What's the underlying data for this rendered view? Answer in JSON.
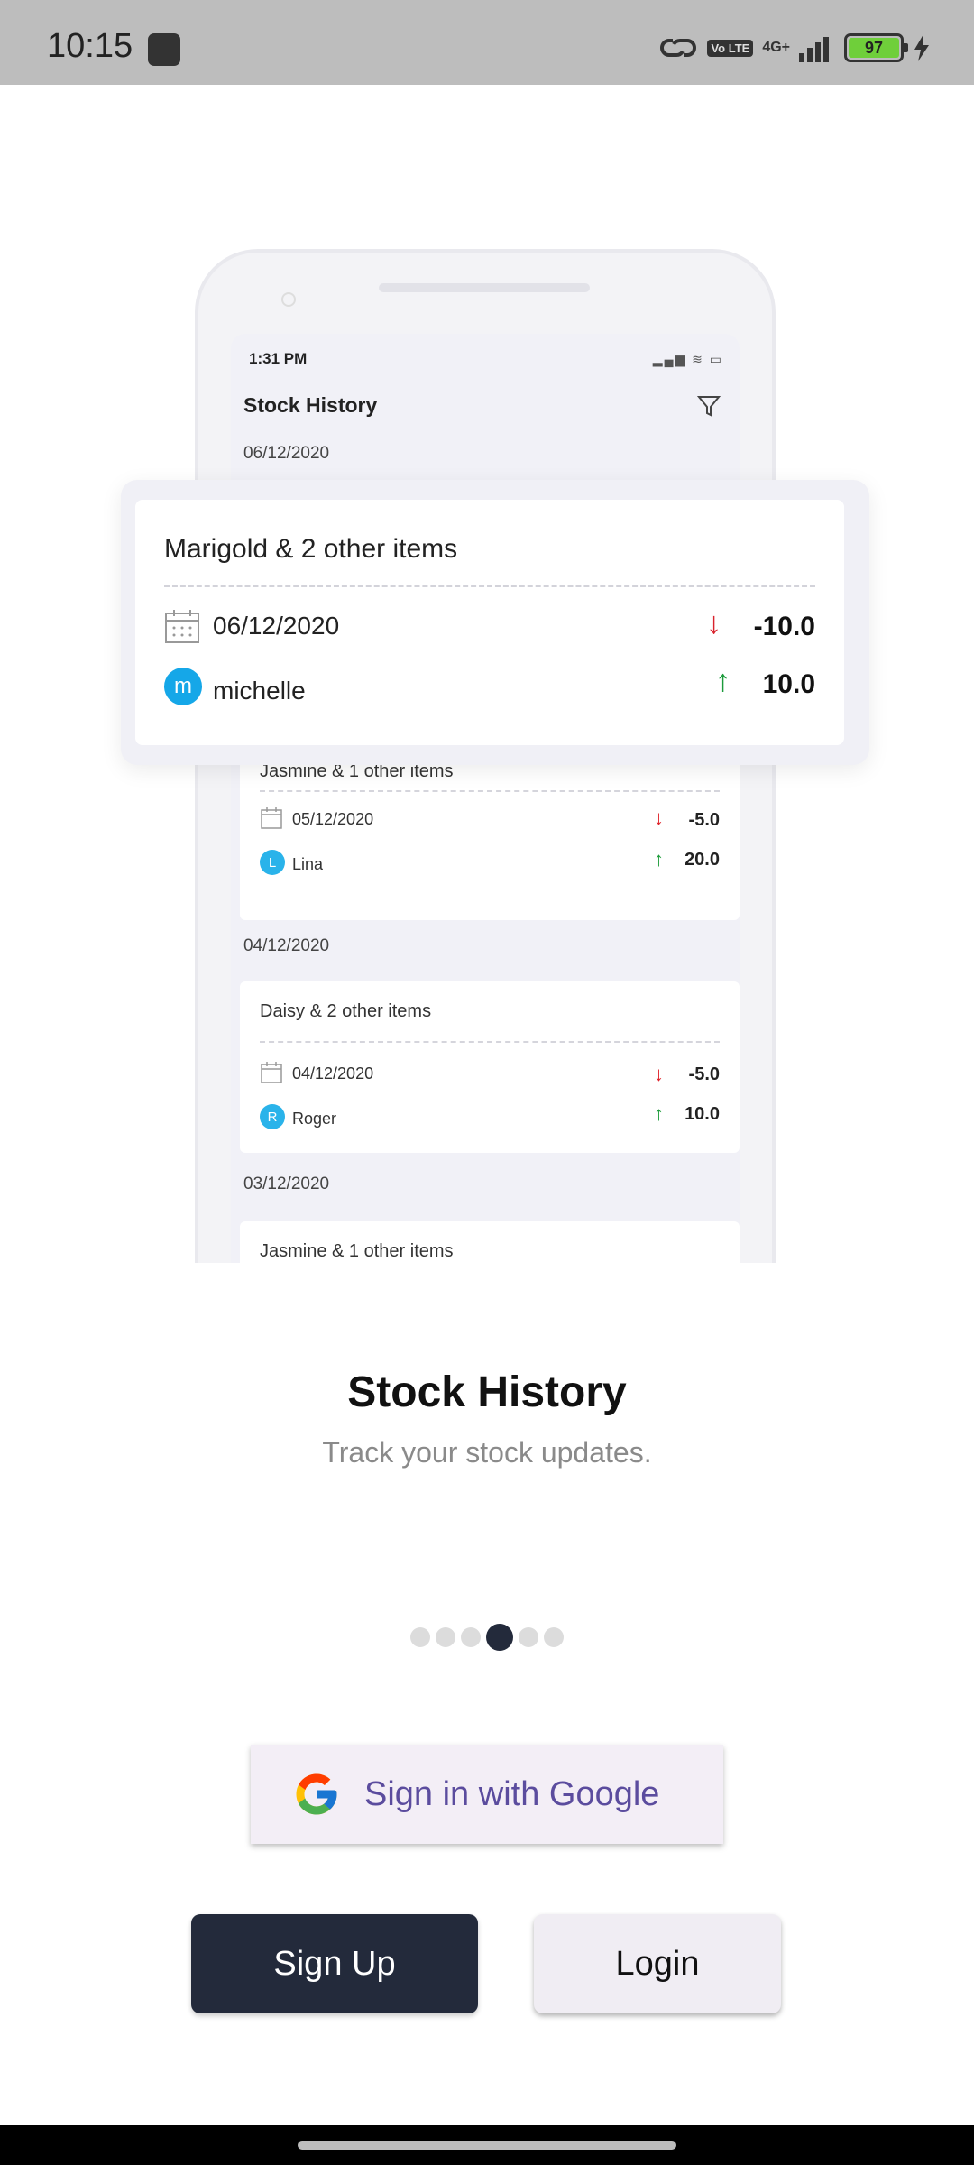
{
  "status_bar": {
    "time": "10:15",
    "network": "4G+",
    "volte": "Vo LTE",
    "battery": "97"
  },
  "illustration": {
    "time": "1:31 PM",
    "title": "Stock History",
    "featured": {
      "date_header": "06/12/2020",
      "title": "Marigold & 2 other items",
      "date": "06/12/2020",
      "user": "michelle",
      "user_initial": "m",
      "out_value": "-10.0",
      "in_value": "10.0"
    },
    "cards": [
      {
        "title": "Jasmine & 1 other items",
        "date": "05/12/2020",
        "user": "Lina",
        "user_initial": "L",
        "out_value": "-5.0",
        "in_value": "20.0"
      },
      {
        "date_header": "04/12/2020",
        "title": "Daisy & 2 other items",
        "date": "04/12/2020",
        "user": "Roger",
        "user_initial": "R",
        "out_value": "-5.0",
        "in_value": "10.0"
      },
      {
        "date_header": "03/12/2020",
        "title": "Jasmine & 1 other items"
      }
    ]
  },
  "onboarding": {
    "title": "Stock History",
    "subtitle": "Track your stock updates.",
    "page_index": 3,
    "page_count": 6
  },
  "buttons": {
    "google": "Sign in with Google",
    "signup": "Sign Up",
    "login": "Login"
  },
  "colors": {
    "primary_dark": "#232a3b",
    "google_text": "#5b4c9e",
    "down_red": "#d9232d",
    "up_green": "#1c9a3b"
  }
}
